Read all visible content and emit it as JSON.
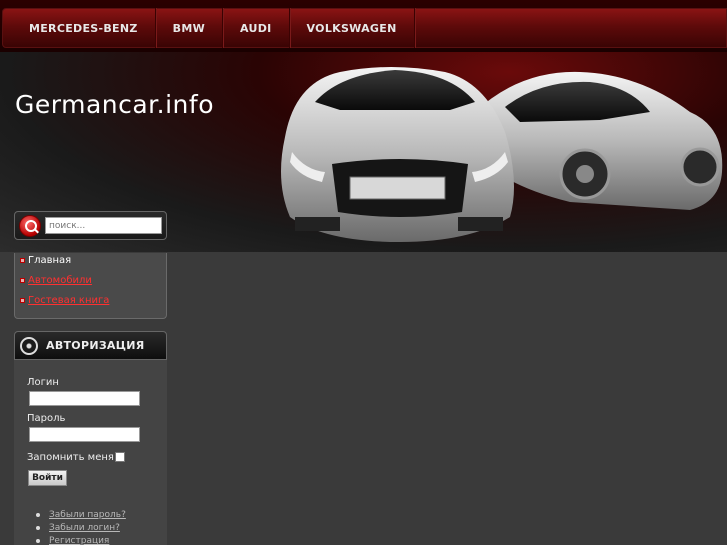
{
  "nav": {
    "items": [
      {
        "label": "MERCEDES-BENZ"
      },
      {
        "label": "BMW"
      },
      {
        "label": "AUDI"
      },
      {
        "label": "VOLKSWAGEN"
      }
    ]
  },
  "header": {
    "site_title": "Germancar.info"
  },
  "search": {
    "placeholder": "поиск..."
  },
  "menu": {
    "items": [
      {
        "label": "Главная"
      },
      {
        "label": "Автомобили"
      },
      {
        "label": "Гостевая книга"
      }
    ]
  },
  "auth": {
    "title": "АВТОРИЗАЦИЯ",
    "login_label": "Логин",
    "password_label": "Пароль",
    "remember_label": "Запомнить меня",
    "submit_label": "Войти",
    "links": [
      {
        "label": "Забыли пароль?"
      },
      {
        "label": "Забыли логин?"
      },
      {
        "label": "Регистрация"
      }
    ]
  },
  "colors": {
    "accent": "#8a1414",
    "link": "#ff3030",
    "background": "#3a3a3a"
  }
}
